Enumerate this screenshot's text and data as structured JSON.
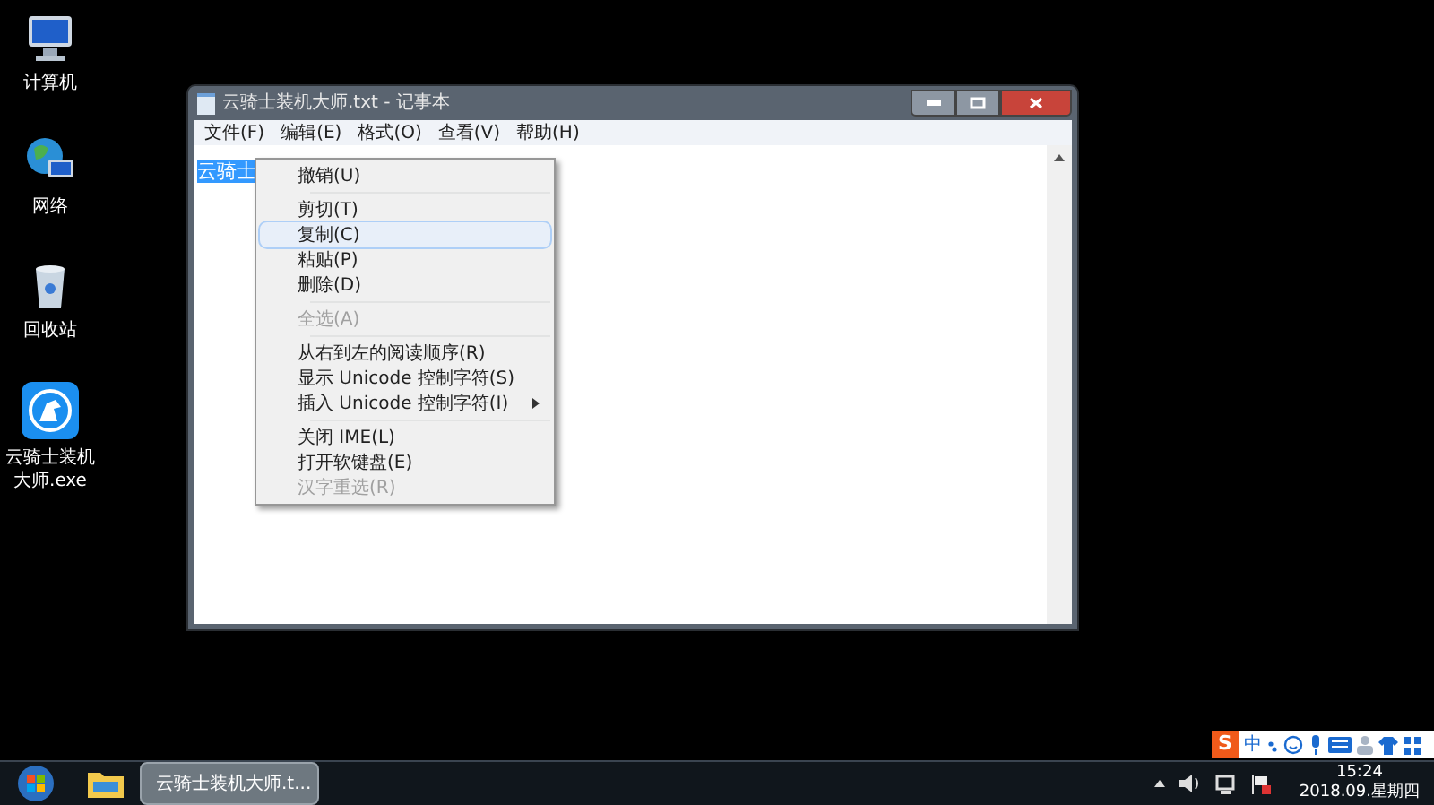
{
  "desktop_icons": [
    {
      "kind": "computer",
      "label": "计算机"
    },
    {
      "kind": "network",
      "label": "网络"
    },
    {
      "kind": "recycle",
      "label": "回收站"
    },
    {
      "kind": "app",
      "label": "云骑士装机大师.exe"
    }
  ],
  "window": {
    "title": "云骑士装机大师.txt - 记事本",
    "menu": [
      "文件(F)",
      "编辑(E)",
      "格式(O)",
      "查看(V)",
      "帮助(H)"
    ],
    "text": "云骑士",
    "text_selected": true
  },
  "context_menu": [
    {
      "kind": "item",
      "label": "撤销(U)",
      "disabled": false,
      "selected": false
    },
    {
      "kind": "separator"
    },
    {
      "kind": "item",
      "label": "剪切(T)",
      "disabled": false,
      "selected": false
    },
    {
      "kind": "item",
      "label": "复制(C)",
      "disabled": false,
      "selected": true
    },
    {
      "kind": "item",
      "label": "粘贴(P)",
      "disabled": false,
      "selected": false
    },
    {
      "kind": "item",
      "label": "删除(D)",
      "disabled": false,
      "selected": false
    },
    {
      "kind": "separator"
    },
    {
      "kind": "item",
      "label": "全选(A)",
      "disabled": true,
      "selected": false
    },
    {
      "kind": "separator"
    },
    {
      "kind": "item",
      "label": "从右到左的阅读顺序(R)",
      "disabled": false,
      "selected": false
    },
    {
      "kind": "item",
      "label": "显示 Unicode 控制字符(S)",
      "disabled": false,
      "selected": false
    },
    {
      "kind": "submenu",
      "label": "插入 Unicode 控制字符(I)",
      "disabled": false,
      "selected": false
    },
    {
      "kind": "separator"
    },
    {
      "kind": "item",
      "label": "关闭 IME(L)",
      "disabled": false,
      "selected": false
    },
    {
      "kind": "item",
      "label": "打开软键盘(E)",
      "disabled": false,
      "selected": false
    },
    {
      "kind": "item",
      "label": "汉字重选(R)",
      "disabled": true,
      "selected": false
    }
  ],
  "ime_bar": {
    "logo": "S",
    "mode": "中"
  },
  "taskbar": {
    "task": "云骑士装机大师.t...",
    "time": "15:24",
    "date": "2018.09.星期四"
  }
}
